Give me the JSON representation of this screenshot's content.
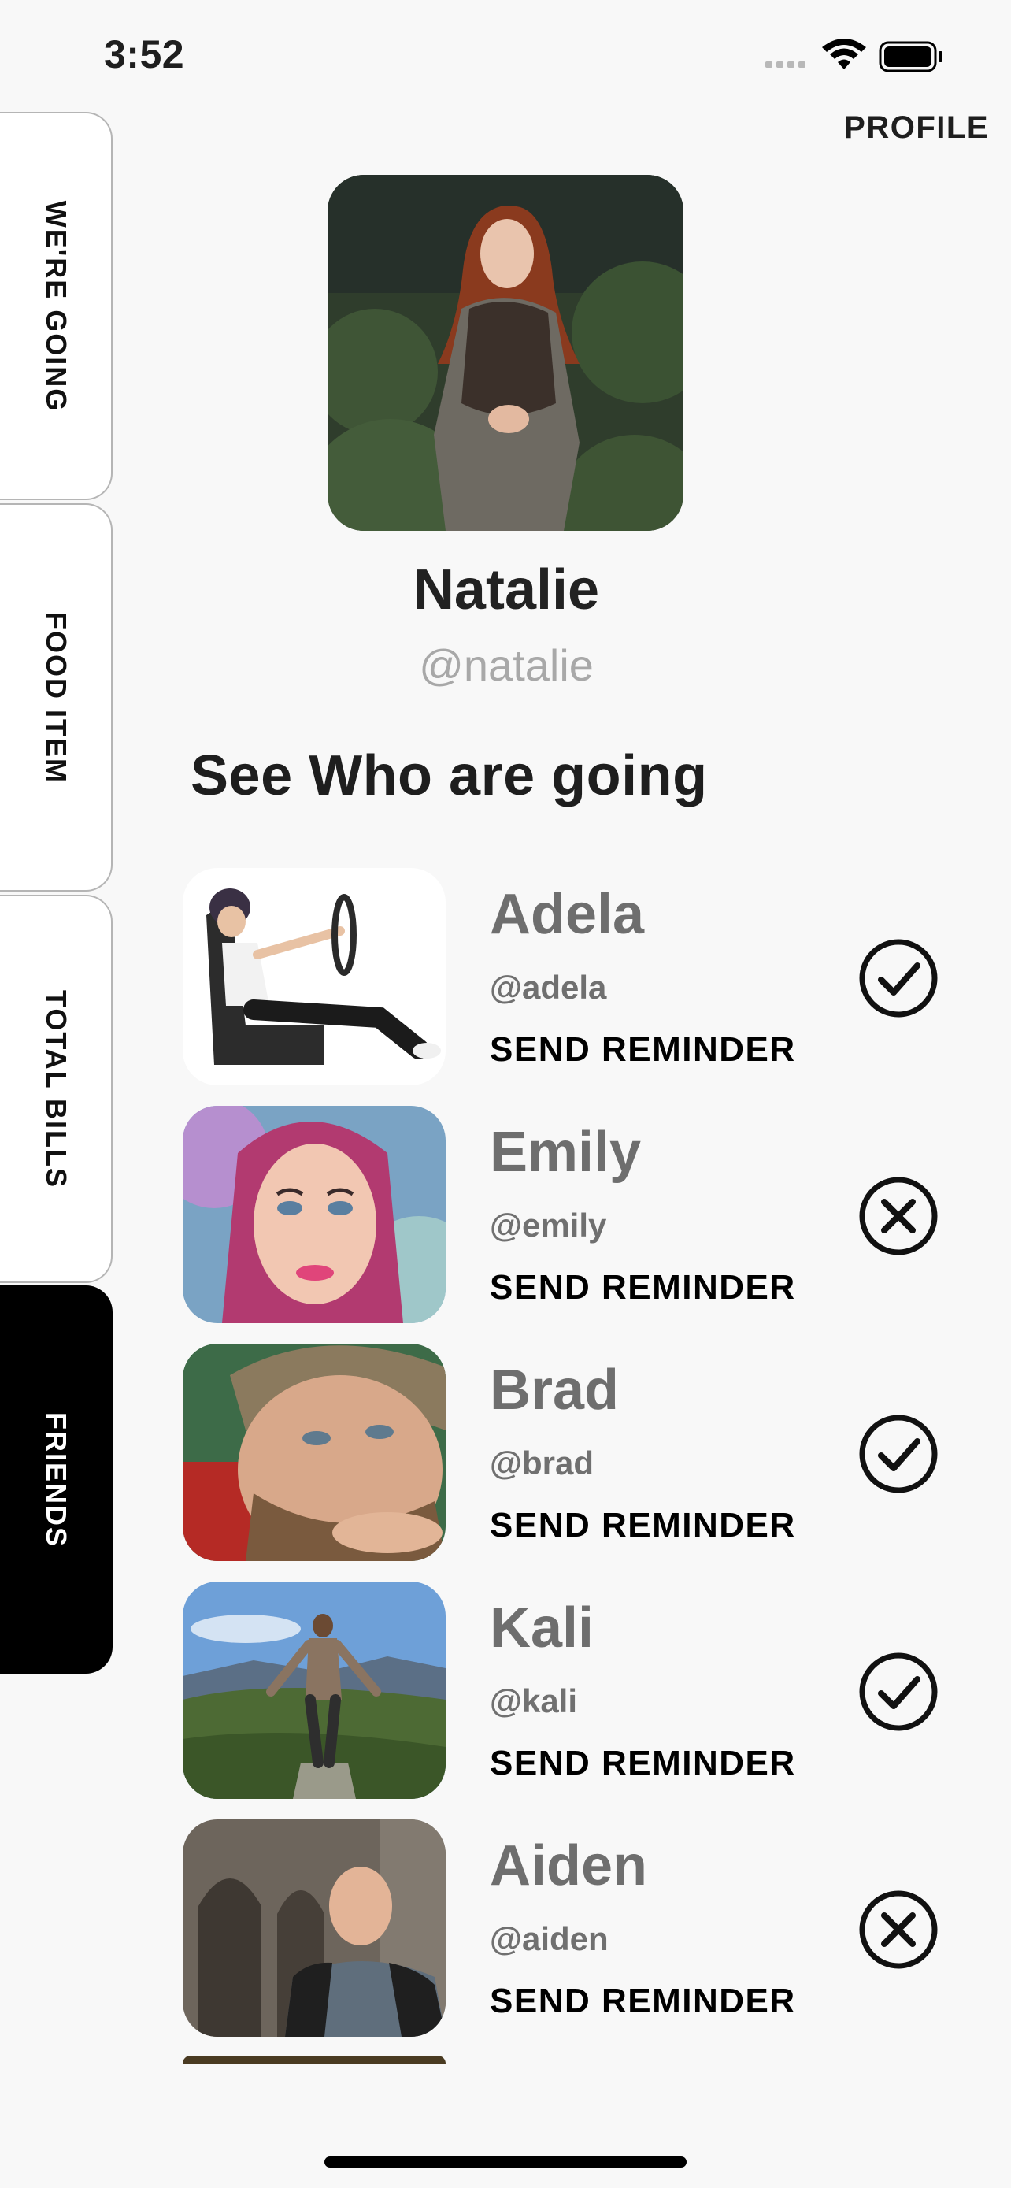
{
  "status_bar": {
    "time": "3:52"
  },
  "header": {
    "profile_label": "PROFILE"
  },
  "side_tabs": [
    {
      "label": "WE'RE GOING",
      "active": false
    },
    {
      "label": "FOOD ITEM",
      "active": false
    },
    {
      "label": "TOTAL BILLS",
      "active": false
    },
    {
      "label": "FRIENDS",
      "active": true
    }
  ],
  "user": {
    "name": "Natalie",
    "handle": "@natalie"
  },
  "section_title": "See Who are going",
  "friends": [
    {
      "name": "Adela",
      "handle": "@adela",
      "action": "SEND REMINDER",
      "status": "going",
      "status_icon": "check-circle-icon"
    },
    {
      "name": "Emily",
      "handle": "@emily",
      "action": "SEND REMINDER",
      "status": "not-going",
      "status_icon": "x-circle-icon"
    },
    {
      "name": "Brad",
      "handle": "@brad",
      "action": "SEND REMINDER",
      "status": "going",
      "status_icon": "check-circle-icon"
    },
    {
      "name": "Kali",
      "handle": "@kali",
      "action": "SEND REMINDER",
      "status": "going",
      "status_icon": "check-circle-icon"
    },
    {
      "name": "Aiden",
      "handle": "@aiden",
      "action": "SEND REMINDER",
      "status": "not-going",
      "status_icon": "x-circle-icon"
    }
  ],
  "colors": {
    "background": "#f8f8f8",
    "active_tab": "#000000",
    "inactive_tab": "#ffffff",
    "friend_name": "#6e6e6e",
    "handle": "#a8a8a8"
  }
}
